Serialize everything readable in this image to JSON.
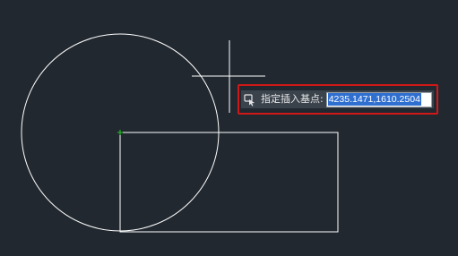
{
  "canvas": {
    "background": "#212830",
    "line_color": "#ffffff",
    "basepoint_color": "#22cc22"
  },
  "dynamic_input": {
    "icon": "insert-basepoint-icon",
    "prompt_label": "指定插入基点:",
    "coordinate_value": "4235.1471,1610.2504",
    "highlight_color": "#d01818",
    "selection_color": "#2f6fd0"
  }
}
